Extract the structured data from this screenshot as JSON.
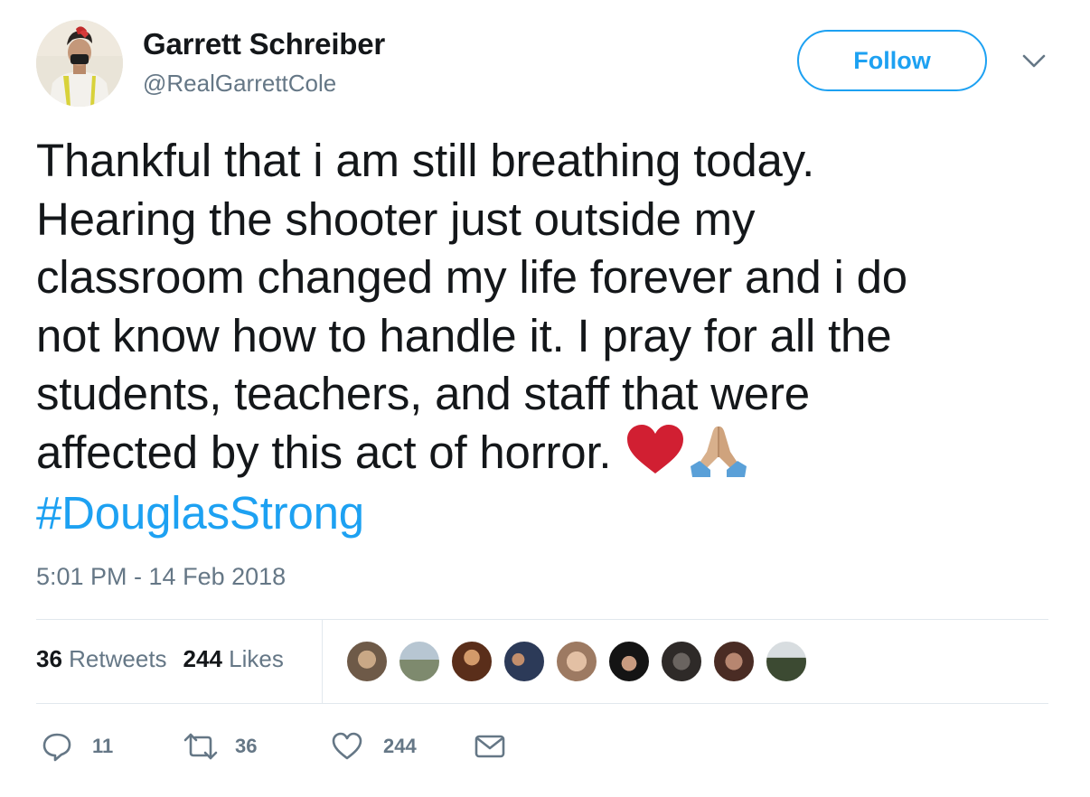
{
  "user": {
    "display_name": "Garrett Schreiber",
    "handle": "@RealGarrettCole",
    "avatar_icon": "profile-photo"
  },
  "follow_button": {
    "label": "Follow",
    "color": "#1da1f2"
  },
  "menu": {
    "icon": "chevron-down-icon"
  },
  "tweet": {
    "text_line1": "Thankful that i am still breathing today.",
    "text_line2": "Hearing the shooter just outside my",
    "text_line3": "classroom changed my life forever and i do",
    "text_line4": "not know how to handle it. I pray for all the",
    "text_line5": "students, teachers, and staff that were",
    "text_line6": "affected by this act of horror.",
    "emojis": [
      "red-heart-icon",
      "folded-hands-icon"
    ],
    "hashtag": "#DouglasStrong",
    "hashtag_color": "#1da1f2"
  },
  "timestamp": "5:01 PM - 14 Feb 2018",
  "stats": {
    "retweets_count": "36",
    "retweets_label": "Retweets",
    "likes_count": "244",
    "likes_label": "Likes",
    "liker_avatar_count": 9
  },
  "actions": {
    "reply": {
      "icon": "reply-icon",
      "count": "11"
    },
    "retweet": {
      "icon": "retweet-icon",
      "count": "36"
    },
    "like": {
      "icon": "heart-icon",
      "count": "244"
    },
    "message": {
      "icon": "envelope-icon"
    }
  },
  "colors": {
    "text": "#14171a",
    "secondary": "#657786",
    "accent": "#1da1f2",
    "divider": "#e1e8ed"
  }
}
